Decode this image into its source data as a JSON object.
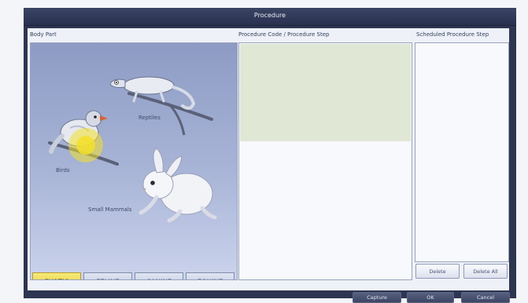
{
  "window": {
    "title": "Procedure"
  },
  "headers": {
    "body_part": "Body Part",
    "procedure": "Procedure Code / Procedure Step",
    "scheduled": "Scheduled Procedure Step"
  },
  "animals": {
    "reptiles": "Reptiles",
    "birds": "Birds",
    "small_mammals": "Small Mammals"
  },
  "tabs": [
    {
      "label": "EXOTIC",
      "active": true
    },
    {
      "label": "FELINE",
      "active": false
    },
    {
      "label": "CANINE",
      "active": false
    },
    {
      "label": "EQUINE",
      "active": false
    }
  ],
  "scheduled_buttons": {
    "delete": "Delete",
    "delete_all": "Delete All"
  },
  "footer": {
    "capture": "Capture",
    "ok": "OK",
    "cancel": "Cancel"
  },
  "colors": {
    "active_tab": "#ecd650",
    "selection_marker": "#f3e02a",
    "procedure_highlight": "#e0e7d5"
  }
}
